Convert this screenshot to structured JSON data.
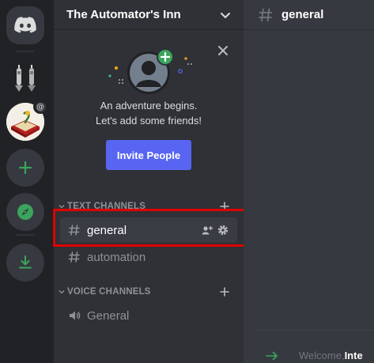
{
  "guild": {
    "name": "The Automator's Inn"
  },
  "invite_card": {
    "line1": "An adventure begins.",
    "line2": "Let's add some friends!",
    "button": "Invite People"
  },
  "categories": {
    "text": "TEXT CHANNELS",
    "voice": "VOICE CHANNELS"
  },
  "channels": {
    "text": [
      {
        "name": "general",
        "active": true
      },
      {
        "name": "automation",
        "active": false
      }
    ],
    "voice": [
      {
        "name": "General"
      }
    ]
  },
  "main": {
    "channel_title": "general",
    "welcome_prefix": "Welcome, ",
    "welcome_name": "Inte"
  },
  "colors": {
    "accent": "#5865f2",
    "green": "#3ba55d",
    "highlight": "#e00000"
  },
  "icons": {
    "home": "discord-logo-icon",
    "add": "plus-icon",
    "explore": "compass-icon",
    "download": "download-icon"
  }
}
